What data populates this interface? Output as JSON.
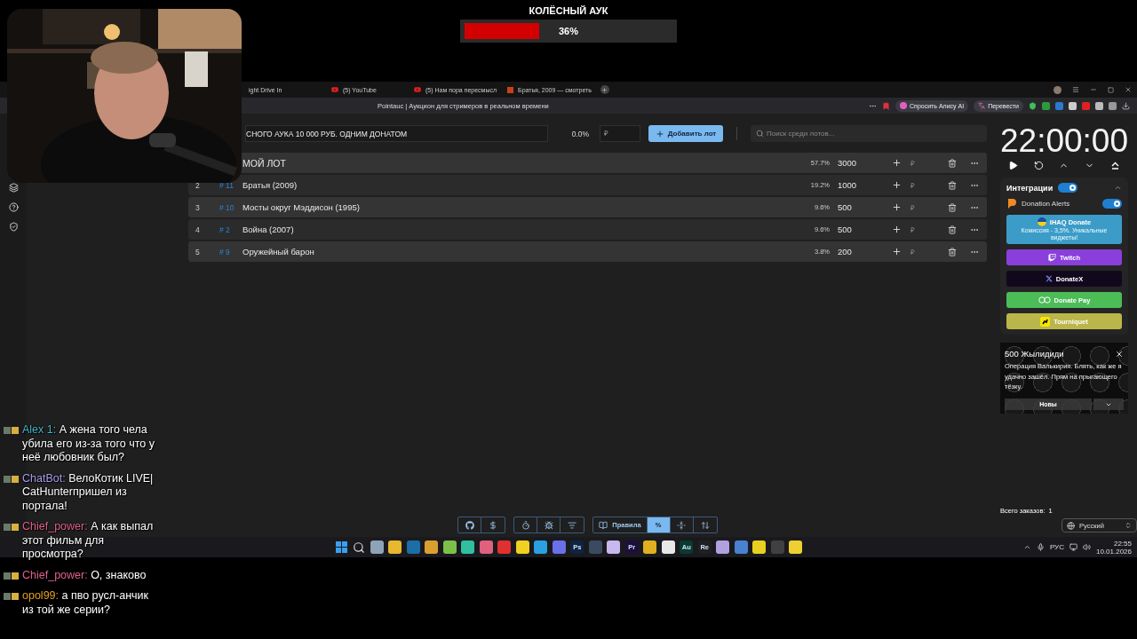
{
  "overlay_bar": {
    "title": "КОЛЁСНЫЙ АУК",
    "level": 0.36,
    "reading": "36%"
  },
  "browser": {
    "tabs": [
      {
        "title": "ight Drive In",
        "kind": "plain"
      },
      {
        "title": "(5) YouTube",
        "kind": "youtube"
      },
      {
        "title": "(5) Нам пора пересмысл",
        "kind": "youtube"
      },
      {
        "title": "Братья, 2009 — смотреть",
        "kind": "film"
      }
    ],
    "page_title": "Pointauc | Аукцион для стримеров в реальном времени",
    "alice_button": "Спросить Алису AI",
    "translate_button": "Перевести"
  },
  "auction": {
    "title_value": "СНОГО АУКА 10 000 РУБ. ОДНИМ ДОНАТОМ",
    "percent": "0.0%",
    "amount_placeholder": "₽",
    "add_button": "Добавить лот",
    "search_placeholder": "Поиск среди лотов...",
    "lots": [
      {
        "name": "МОЙ ЛОТ",
        "percent": "57.7%",
        "amount": "3000",
        "currency": "₽"
      },
      {
        "index": "2",
        "id": "# 11",
        "name": "Братья (2009)",
        "percent": "19.2%",
        "amount": "1000",
        "currency": "₽"
      },
      {
        "index": "3",
        "id": "# 10",
        "name": "Мосты округ Мэддисон (1995)",
        "percent": "9.6%",
        "amount": "500",
        "currency": "₽"
      },
      {
        "index": "4",
        "id": "# 2",
        "name": "Война (2007)",
        "percent": "9.6%",
        "amount": "500",
        "currency": "₽"
      },
      {
        "index": "5",
        "id": "# 9",
        "name": "Оружейный барон",
        "percent": "3.8%",
        "amount": "200",
        "currency": "₽"
      }
    ]
  },
  "toolbar": [
    {
      "buttons": [
        {
          "selected": false
        },
        {
          "selected": false
        }
      ]
    },
    {
      "buttons": [
        {
          "selected": false
        },
        {
          "selected": false
        },
        {
          "selected": false
        }
      ]
    },
    {
      "buttons": [
        {
          "label": "Правила",
          "selected": false
        },
        {
          "label": "%",
          "selected": true
        },
        {
          "selected": false
        },
        {
          "selected": false
        }
      ]
    }
  ],
  "timer": "22:00:00",
  "integrations": {
    "label": "Интеграции",
    "on": true,
    "expanded": true,
    "services": [
      {
        "kind": "toggle",
        "name": "Donation Alerts",
        "on": true
      },
      {
        "kind": "button",
        "name": "IHAQ Donate",
        "subtitle": "Комиссия - 3,5%. Уникальные виджеты!",
        "color": "#3c9cc8"
      },
      {
        "kind": "button",
        "name": "Twitch",
        "color": "#8a3fdc"
      },
      {
        "kind": "button",
        "name": "DonateX",
        "color": "#12081e"
      },
      {
        "kind": "button",
        "name": "Donate Pay",
        "color": "#4cbc57"
      },
      {
        "kind": "button",
        "name": "Tourniquet",
        "color": "#bbb64a"
      }
    ]
  },
  "notification": {
    "title": "500 Жылидиди",
    "message": "Операция Валькирия. Блять, как же я удачно зашёл. Прям на прыгающего тёзку.",
    "action": "Новы"
  },
  "orders": {
    "label": "Всего заказов:",
    "count": "1"
  },
  "language": "Русский",
  "taskbar": {
    "apps": [
      {
        "kind": "windows"
      },
      {
        "kind": "search"
      },
      {
        "kind": "tile",
        "color": "#8fa3b8"
      },
      {
        "kind": "tile",
        "color": "#e8b830"
      },
      {
        "kind": "tile",
        "color": "#1b6ea8"
      },
      {
        "kind": "tile",
        "color": "#d9a030"
      },
      {
        "kind": "tile",
        "color": "#7cc04a"
      },
      {
        "kind": "tile",
        "color": "#30c0a0"
      },
      {
        "kind": "tile",
        "color": "#e06080"
      },
      {
        "kind": "tile",
        "color": "#e03030"
      },
      {
        "kind": "tile",
        "color": "#f0d020"
      },
      {
        "kind": "tile",
        "color": "#2aa0e0"
      },
      {
        "kind": "tile",
        "color": "#6a70e8"
      },
      {
        "kind": "letters",
        "label": "Ps",
        "color": "#0e2440"
      },
      {
        "kind": "tile",
        "color": "#3a4a60"
      },
      {
        "kind": "tile",
        "color": "#c8b8f0"
      },
      {
        "kind": "letters",
        "label": "Pr",
        "color": "#1c0f3c"
      },
      {
        "kind": "tile",
        "color": "#e0b020"
      },
      {
        "kind": "tile",
        "color": "#e8e8e8"
      },
      {
        "kind": "letters",
        "label": "Au",
        "color": "#0a3a30"
      },
      {
        "kind": "letters",
        "label": "Re",
        "color": "#202020"
      },
      {
        "kind": "tile",
        "color": "#b0a0e0"
      },
      {
        "kind": "tile",
        "color": "#4a80d0"
      },
      {
        "kind": "tile",
        "color": "#e8d020"
      },
      {
        "kind": "tile",
        "color": "#404040"
      },
      {
        "kind": "tile",
        "color": "#f0d030"
      }
    ],
    "language": "РУС",
    "time": "22:55",
    "date": "10.01.2026"
  },
  "chat": [
    {
      "user": "Alex 1:",
      "color": "#3fb8c8",
      "text": "А жена того чела убила его из-за того что у неё любовник был?"
    },
    {
      "user": "ChatBot:",
      "color": "#a99cf0",
      "text": "ВелоКотик LIVE| CatHunterпришел из портала!"
    },
    {
      "user": "Chief_power:",
      "color": "#e0608a",
      "text": "А как выпал этот фильм для просмотра?"
    },
    {
      "user": "Chief_power:",
      "color": "#e0608a",
      "text": "О, знаково"
    },
    {
      "user": "opol99:",
      "color": "#e0a020",
      "text": "а пво русл-анчик из той же серии?"
    }
  ]
}
